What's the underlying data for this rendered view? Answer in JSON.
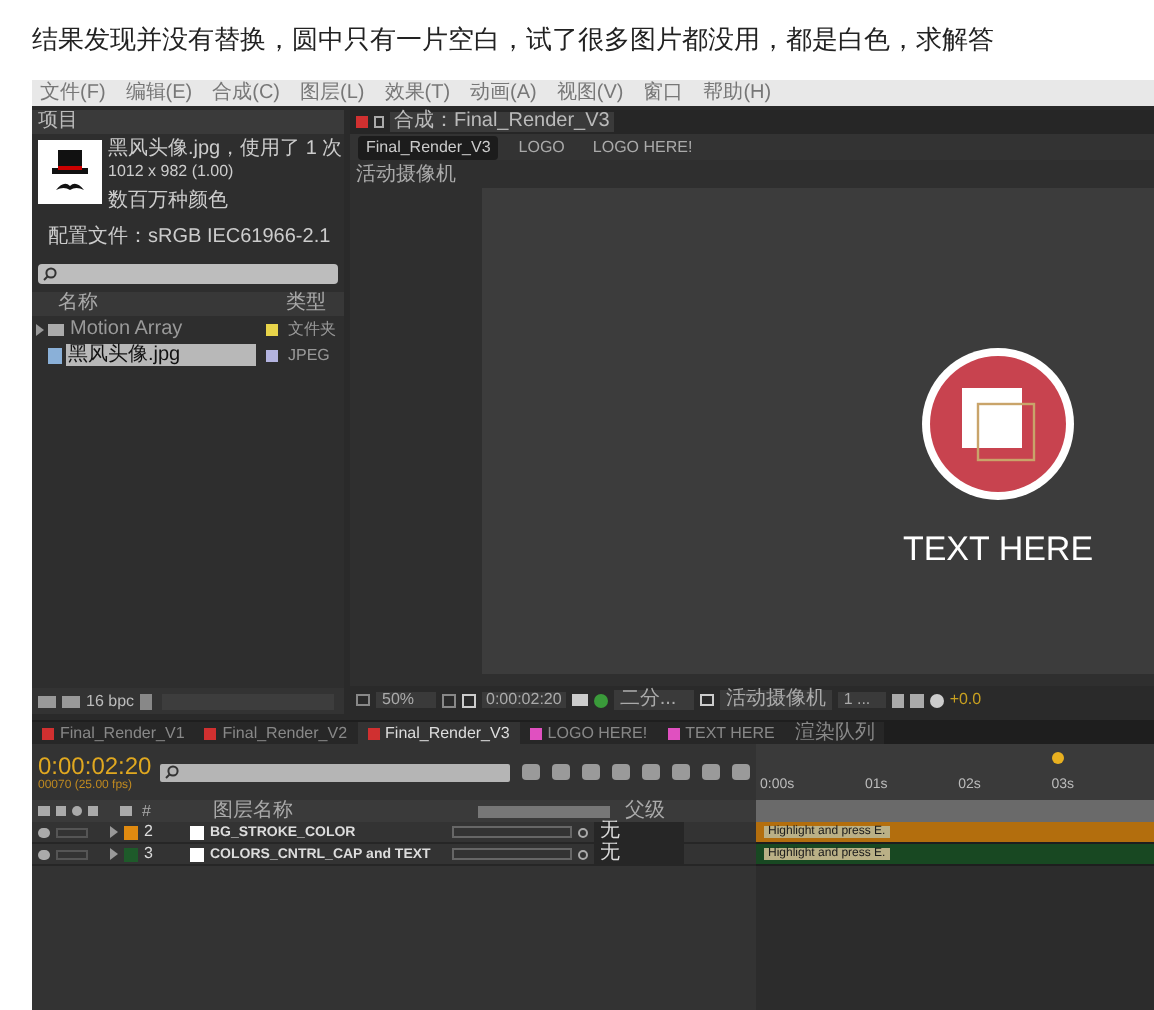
{
  "post_text": "结果发现并没有替换，圆中只有一片空白，试了很多图片都没用，都是白色，求解答",
  "menu": [
    "文件(F)",
    "编辑(E)",
    "合成(C)",
    "图层(L)",
    "效果(T)",
    "动画(A)",
    "视图(V)",
    "窗口",
    "帮助(H)"
  ],
  "project_panel": {
    "tab": "项目",
    "file_name": "黑风头像.jpg",
    "usage": "，使用了 1 次",
    "dimensions": "1012 x 982 (1.00)",
    "colors": "数百万种颜色",
    "profile": "配置文件：sRGB IEC61966-2.1",
    "columns": [
      "名称",
      "类型"
    ],
    "items": [
      {
        "kind": "folder",
        "name": "Motion Array",
        "type": "文件夹",
        "color": "#e8d44a",
        "selected": false
      },
      {
        "kind": "image",
        "name": "黑风头像.jpg",
        "type": "JPEG",
        "color": "#b4b4e0",
        "selected": true
      }
    ],
    "bpc": "16 bpc"
  },
  "composition_panel": {
    "tab": "合成：Final_Render_V3",
    "breadcrumbs": [
      {
        "label": "Final_Render_V3",
        "selected": true
      },
      {
        "label": "LOGO",
        "selected": false
      },
      {
        "label": "LOGO HERE!",
        "selected": false
      }
    ],
    "camera_label": "活动摄像机",
    "canvas_text": "TEXT HERE",
    "zoom": "50%",
    "timecode": "0:00:02:20",
    "resolution": "二分...",
    "camera": "活动摄像机",
    "views": "1 ...",
    "exposure": "+0.0"
  },
  "timeline_tabs": [
    {
      "label": "Final_Render_V1",
      "color": "#d03030",
      "selected": false
    },
    {
      "label": "Final_Render_V2",
      "color": "#d03030",
      "selected": false
    },
    {
      "label": "Final_Render_V3",
      "color": "#d03030",
      "selected": true
    },
    {
      "label": "LOGO HERE!",
      "color": "#e050c0",
      "selected": false
    },
    {
      "label": "TEXT HERE",
      "color": "#e050c0",
      "selected": false
    },
    {
      "label": "渲染队列",
      "selected": false
    }
  ],
  "timeline": {
    "current_time": "0:00:02:20",
    "frames": "00070 (25.00 fps)",
    "columns": [
      "#",
      "图层名称",
      "父级"
    ],
    "ruler": [
      "0:00s",
      "01s",
      "02s",
      "03s"
    ],
    "layers": [
      {
        "number": "2",
        "name": "BG_STROKE_COLOR",
        "color": "#e08a10",
        "parent": "无",
        "bar_label": "Highlight and press E."
      },
      {
        "number": "3",
        "name": "COLORS_CNTRL_CAP and TEXT",
        "color": "#1e5a2a",
        "parent": "无",
        "bar_label": "Highlight and press E."
      }
    ]
  }
}
